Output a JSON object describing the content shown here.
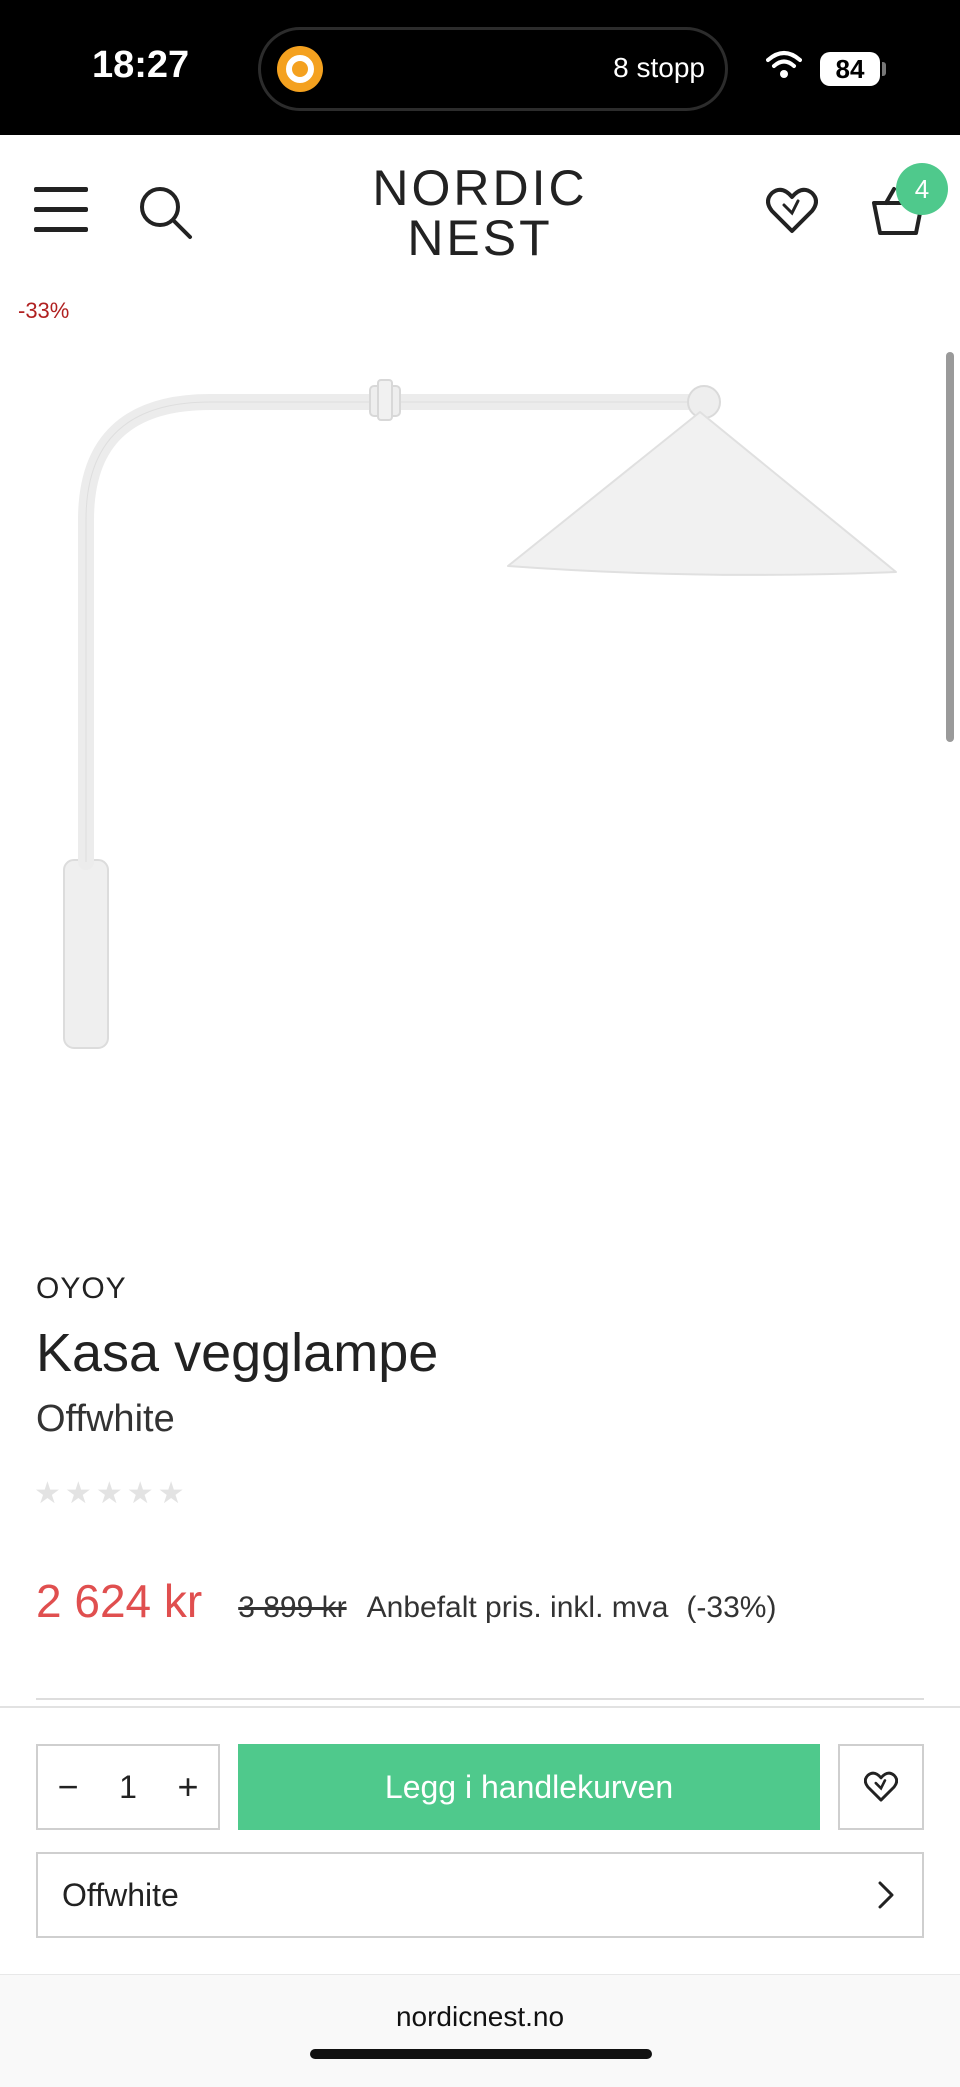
{
  "status_bar": {
    "time": "18:27",
    "island_text": "8 stopp",
    "battery": "84"
  },
  "header": {
    "logo_line1": "NORDIC",
    "logo_line2": "NEST",
    "cart_count": "4"
  },
  "product": {
    "discount_badge": "-33%",
    "brand": "OYOY",
    "title": "Kasa vegglampe",
    "variant": "Offwhite",
    "rating": 0,
    "price_now": "2 624 kr",
    "price_old": "3 899 kr",
    "price_note": "Anbefalt pris. inkl. mva",
    "price_pct": "(-33%)"
  },
  "purchase": {
    "minus": "−",
    "quantity": "1",
    "plus": "+",
    "add_to_cart": "Legg i handlekurven",
    "variant_select": "Offwhite"
  },
  "browser": {
    "url": "nordicnest.no"
  },
  "colors": {
    "accent_green": "#4fc98c",
    "sale_red": "#e04f4f",
    "badge_red": "#b02020"
  }
}
